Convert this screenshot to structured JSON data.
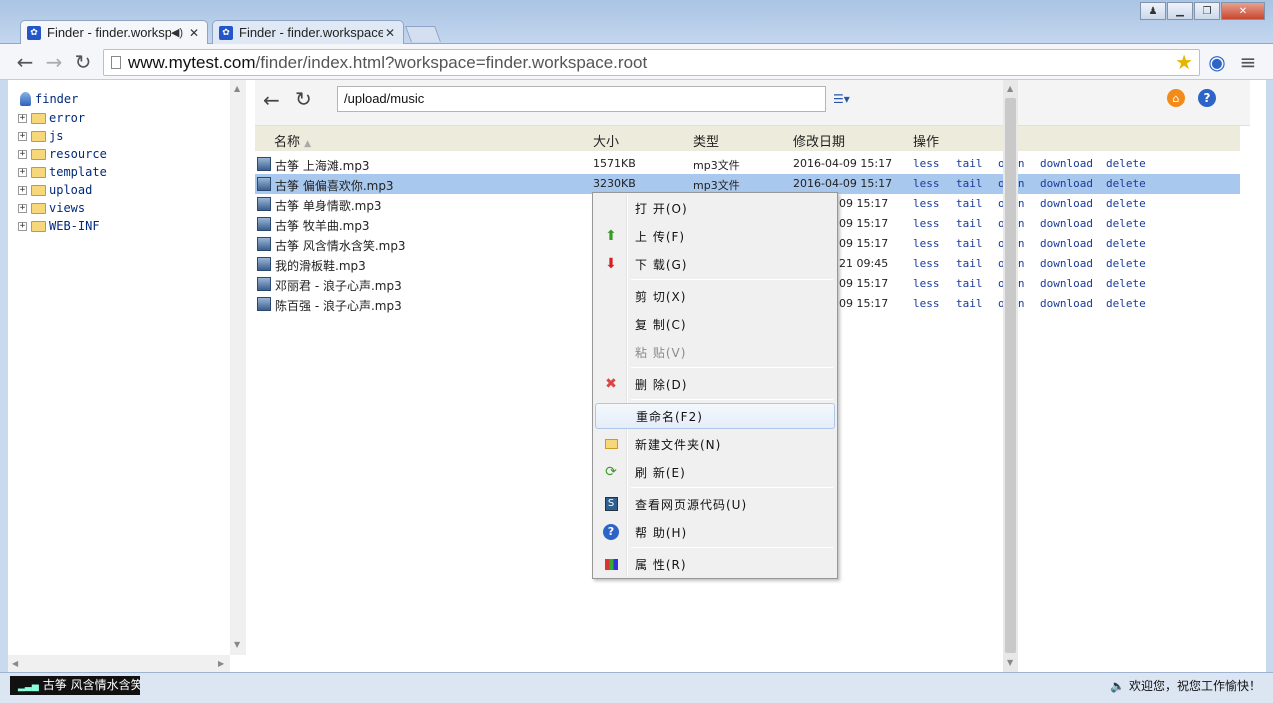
{
  "browser": {
    "tabs": [
      {
        "label": "Finder - finder.workspace.root",
        "active": true
      },
      {
        "label": "Finder - finder.workspace.root",
        "active": false
      }
    ],
    "url_host": "www.mytest.com",
    "url_path": "/finder/index.html?workspace=finder.workspace.root"
  },
  "tree": {
    "root": "finder",
    "items": [
      "error",
      "js",
      "resource",
      "template",
      "upload",
      "views",
      "WEB-INF"
    ]
  },
  "toolbar": {
    "path": "/upload/music"
  },
  "table": {
    "headers": {
      "name": "名称",
      "size": "大小",
      "type": "类型",
      "date": "修改日期",
      "action": "操作"
    },
    "actions": [
      "less",
      "tail",
      "open",
      "download",
      "delete"
    ],
    "rows": [
      {
        "name": "古筝 上海滩.mp3",
        "size": "1571KB",
        "type": "mp3文件",
        "date": "2016-04-09 15:17"
      },
      {
        "name": "古筝 偏偏喜欢你.mp3",
        "size": "3230KB",
        "type": "mp3文件",
        "date": "2016-04-09 15:17"
      },
      {
        "name": "古筝 单身情歌.mp3",
        "size": "",
        "type": "",
        "date": "09 15:17"
      },
      {
        "name": "古筝 牧羊曲.mp3",
        "size": "",
        "type": "",
        "date": "09 15:17"
      },
      {
        "name": "古筝 风含情水含笑.mp3",
        "size": "",
        "type": "",
        "date": "09 15:17"
      },
      {
        "name": "我的滑板鞋.mp3",
        "size": "",
        "type": "",
        "date": "21 09:45"
      },
      {
        "name": "邓丽君 - 浪子心声.mp3",
        "size": "",
        "type": "",
        "date": "09 15:17"
      },
      {
        "name": "陈百强 - 浪子心声.mp3",
        "size": "",
        "type": "",
        "date": "09 15:17"
      }
    ]
  },
  "context_menu": {
    "items": [
      {
        "label": "打 开(O)",
        "icon": "none"
      },
      {
        "label": "上 传(F)",
        "icon": "up-arrow-icon"
      },
      {
        "label": "下 载(G)",
        "icon": "down-arrow-icon"
      },
      {
        "label": "剪 切(X)",
        "icon": "none"
      },
      {
        "label": "复 制(C)",
        "icon": "none"
      },
      {
        "label": "粘 贴(V)",
        "icon": "none"
      },
      {
        "label": "删 除(D)",
        "icon": "delete-icon"
      },
      {
        "label": "重命名(F2)",
        "icon": "none"
      },
      {
        "label": "新建文件夹(N)",
        "icon": "folder-icon"
      },
      {
        "label": "刷 新(E)",
        "icon": "refresh-icon"
      },
      {
        "label": "查看网页源代码(U)",
        "icon": "source-icon"
      },
      {
        "label": "帮 助(H)",
        "icon": "help-icon"
      },
      {
        "label": "属 性(R)",
        "icon": "properties-icon"
      }
    ]
  },
  "status": {
    "player": "古筝 风含情水含笑",
    "welcome": "欢迎您，祝您工作愉快！"
  },
  "colors": {
    "selection": "#a9c8ee",
    "header_bg": "#ecebdc",
    "link": "#1a3a9a"
  }
}
